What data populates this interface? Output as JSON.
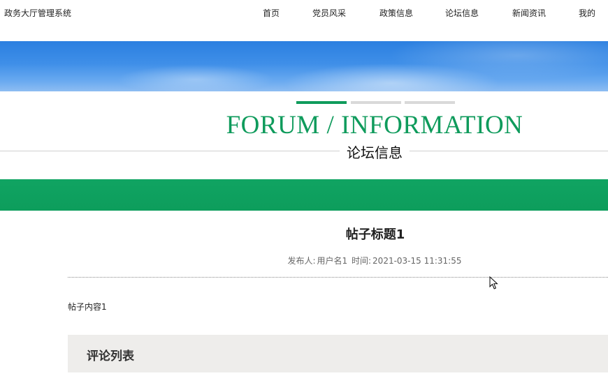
{
  "header": {
    "brand": "政务大厅管理系统",
    "nav": [
      {
        "label": "首页"
      },
      {
        "label": "党员风采"
      },
      {
        "label": "政策信息"
      },
      {
        "label": "论坛信息"
      },
      {
        "label": "新闻资讯"
      },
      {
        "label": "我的"
      }
    ]
  },
  "section": {
    "title_en": "FORUM / INFORMATION",
    "title_cn": "论坛信息"
  },
  "post": {
    "title": "帖子标题1",
    "meta": {
      "publisher_label": "发布人:",
      "publisher": "用户名1",
      "time_label": "时间:",
      "time": "2021-03-15 11:31:55"
    },
    "content": "帖子内容1"
  },
  "comments": {
    "heading": "评论列表"
  },
  "colors": {
    "accent": "#0f9b5c",
    "banner": "#3f8fe8",
    "comments_bg": "#eeedeb"
  }
}
